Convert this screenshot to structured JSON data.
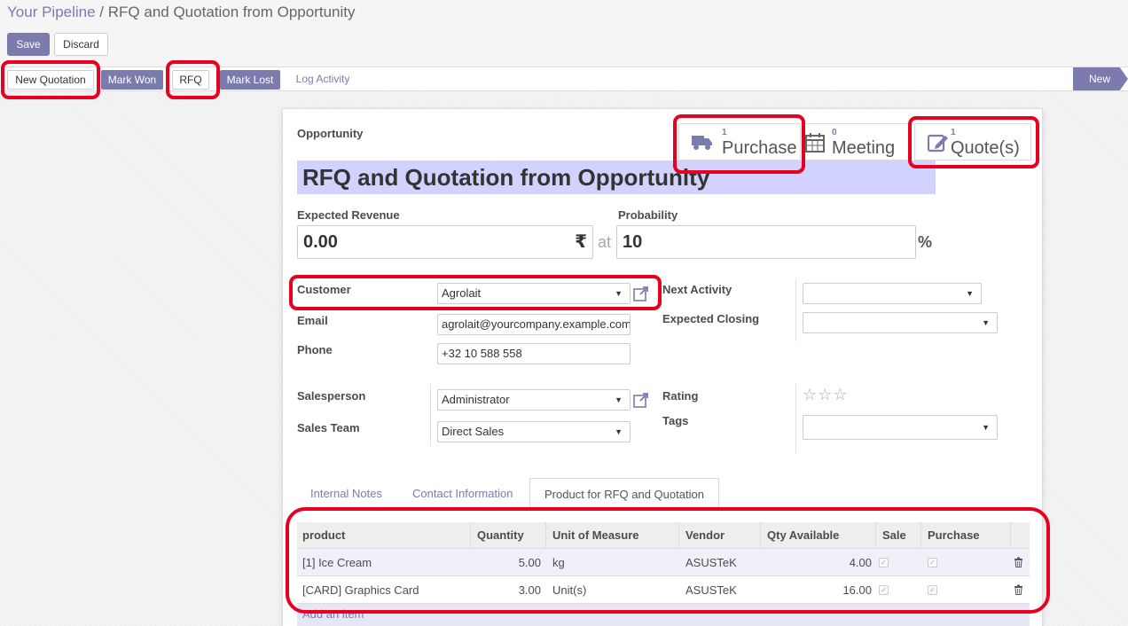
{
  "breadcrumb": {
    "parent": "Your Pipeline",
    "separator": "/",
    "current": "RFQ and Quotation from Opportunity"
  },
  "buttons": {
    "save": "Save",
    "discard": "Discard"
  },
  "statusbar": {
    "actions": [
      "New Quotation",
      "Mark Won",
      "RFQ",
      "Mark Lost",
      "Log Activity"
    ],
    "stage": "New"
  },
  "smart_buttons": {
    "purchase": {
      "count": "1",
      "label": "Purchase"
    },
    "meeting": {
      "count": "0",
      "label": "Meeting"
    },
    "quotes": {
      "count": "1",
      "label": "Quote(s)"
    }
  },
  "form": {
    "section_label": "Opportunity",
    "name": "RFQ and Quotation from Opportunity",
    "expected_revenue_label": "Expected Revenue",
    "expected_revenue": "0.00",
    "currency": "₹",
    "at": "at",
    "probability_label": "Probability",
    "probability": "10",
    "percent": "%",
    "customer_label": "Customer",
    "customer": "Agrolait",
    "email_label": "Email",
    "email": "agrolait@yourcompany.example.com",
    "phone_label": "Phone",
    "phone": "+32 10 588 558",
    "salesperson_label": "Salesperson",
    "salesperson": "Administrator",
    "sales_team_label": "Sales Team",
    "sales_team": "Direct Sales",
    "next_activity_label": "Next Activity",
    "next_activity": "",
    "expected_closing_label": "Expected Closing",
    "expected_closing": "",
    "rating_label": "Rating",
    "rating": 0,
    "rating_max": 3,
    "tags_label": "Tags",
    "tags": ""
  },
  "tabs": [
    "Internal Notes",
    "Contact Information",
    "Product for RFQ and Quotation"
  ],
  "product_table": {
    "columns": [
      "product",
      "Quantity",
      "Unit of Measure",
      "Vendor",
      "Qty Available",
      "Sale",
      "Purchase"
    ],
    "rows": [
      {
        "product": "[1] Ice Cream",
        "quantity": "5.00",
        "uom": "kg",
        "vendor": "ASUSTeK",
        "qty_available": "4.00",
        "sale": true,
        "purchase": true
      },
      {
        "product": "[CARD] Graphics Card",
        "quantity": "3.00",
        "uom": "Unit(s)",
        "vendor": "ASUSTeK",
        "qty_available": "16.00",
        "sale": true,
        "purchase": true
      }
    ],
    "add_item": "Add an item"
  },
  "colors": {
    "accent": "#7c7bad",
    "highlight": "#e8001f",
    "title_bg": "#d2d2ff"
  }
}
